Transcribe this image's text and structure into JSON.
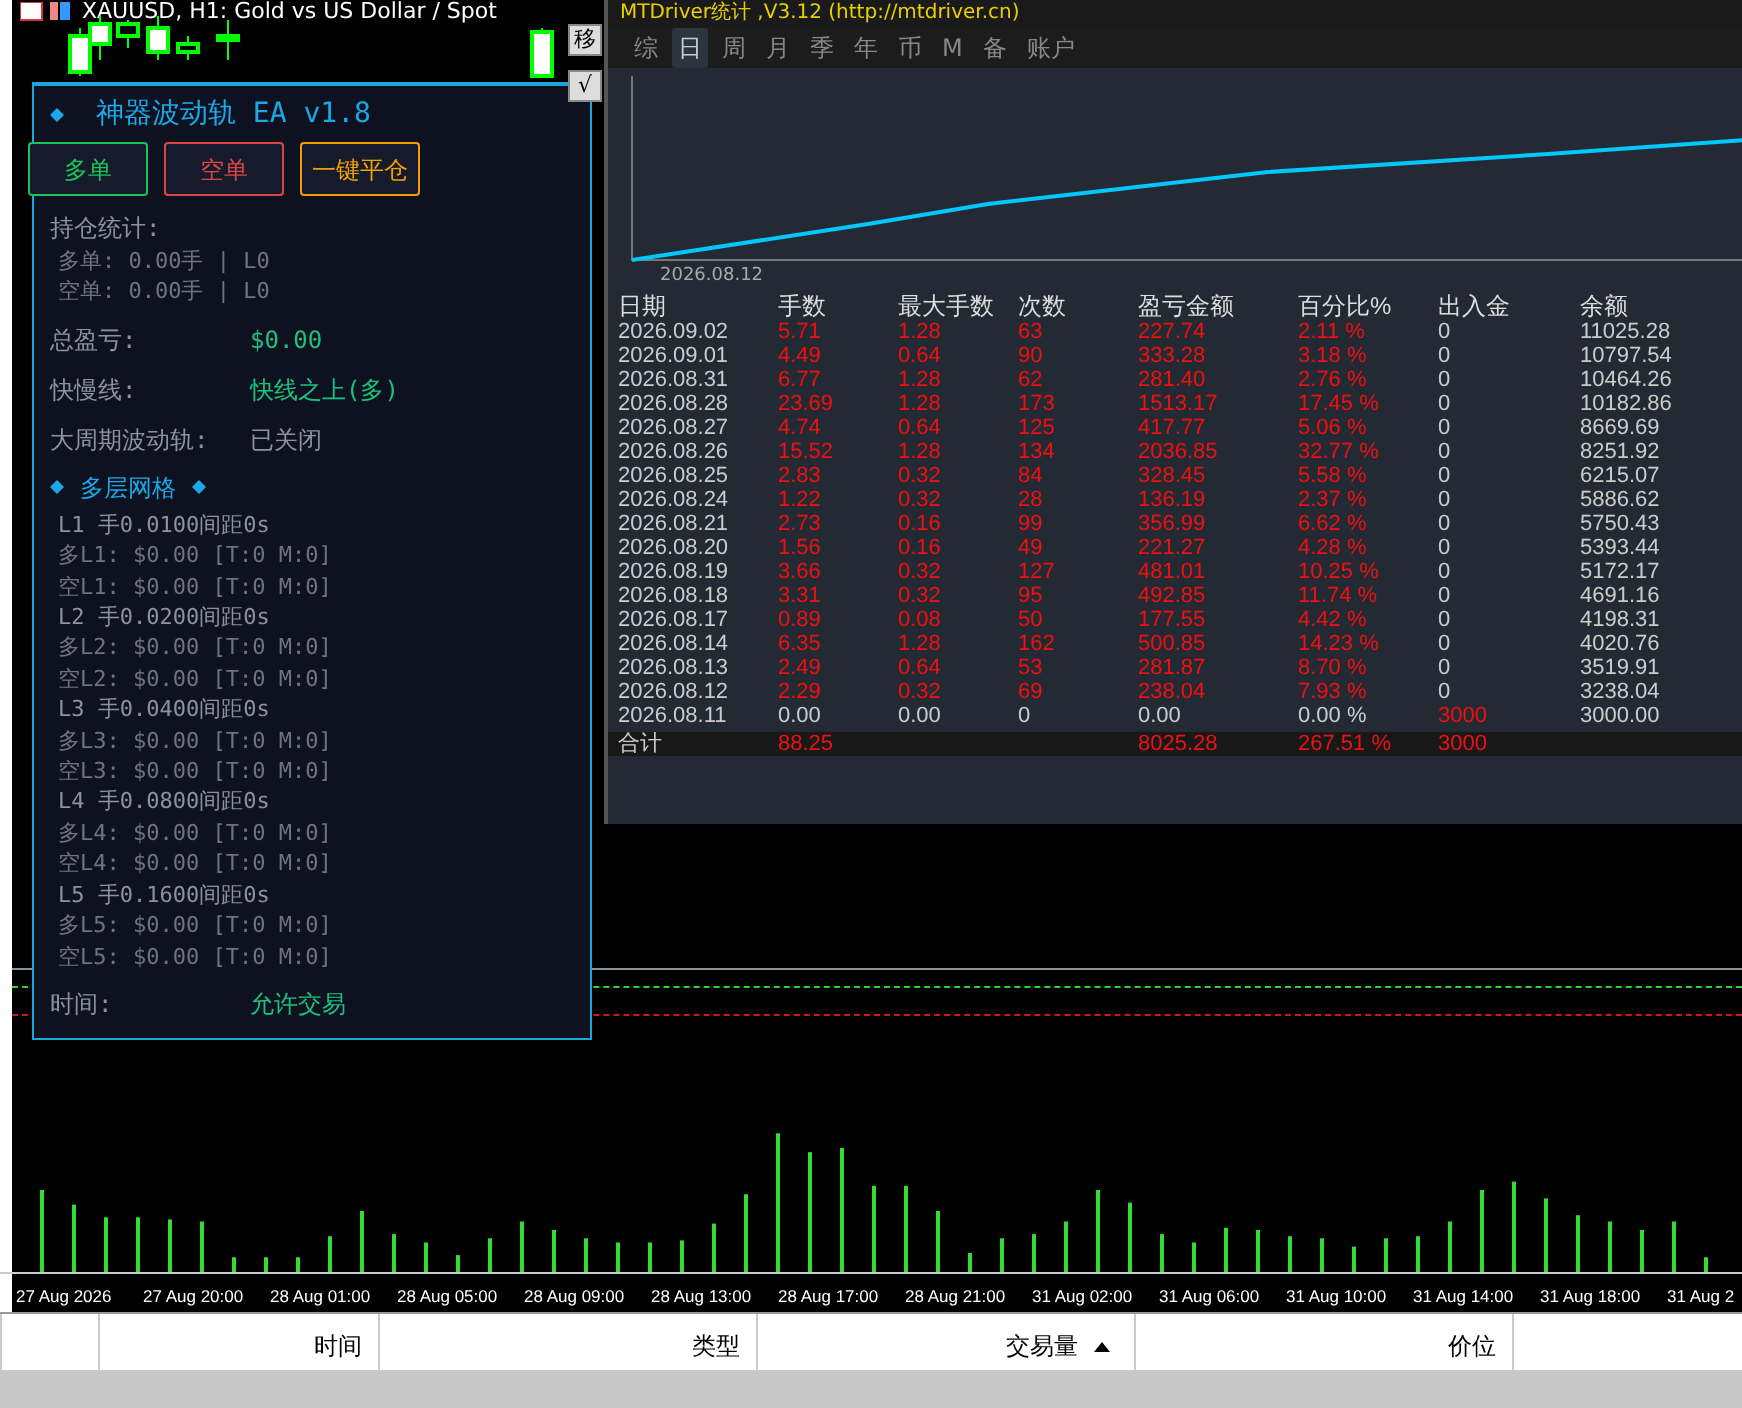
{
  "chart": {
    "title": "XAUUSD, H1: Gold vs US Dollar / Spot",
    "side_buttons": [
      "移",
      "√"
    ],
    "time_axis": [
      "27 Aug 2026",
      "27 Aug 20:00",
      "28 Aug 01:00",
      "28 Aug 05:00",
      "28 Aug 09:00",
      "28 Aug 13:00",
      "28 Aug 17:00",
      "28 Aug 21:00",
      "31 Aug 02:00",
      "31 Aug 06:00",
      "31 Aug 10:00",
      "31 Aug 14:00",
      "31 Aug 18:00",
      "31 Aug 2"
    ]
  },
  "ea_panel": {
    "title": "神器波动轨 EA v1.8",
    "buttons": [
      {
        "label": "多单",
        "kind": "buy"
      },
      {
        "label": "空单",
        "kind": "sell"
      },
      {
        "label": "一键平仓",
        "kind": "close"
      }
    ],
    "lines": [
      {
        "kind": "heading",
        "label": "持仓统计:"
      },
      {
        "kind": "sub",
        "label": "多单: 0.00手 | L0"
      },
      {
        "kind": "sub",
        "label": "空单: 0.00手 | L0"
      },
      {
        "kind": "pair",
        "label": "总盈亏:",
        "value": "$0.00",
        "on": true
      },
      {
        "kind": "pair",
        "label": "快慢线:",
        "value": "快线之上(多)",
        "on": true
      },
      {
        "kind": "pair",
        "label": "大周期波动轨:",
        "value": "已关闭",
        "on": false
      },
      {
        "kind": "section",
        "label": "多层网格"
      },
      {
        "kind": "level",
        "label": "L1 手0.0100间距0s"
      },
      {
        "kind": "sub",
        "label": "多L1: $0.00 [T:0 M:0]"
      },
      {
        "kind": "sub",
        "label": "空L1: $0.00 [T:0 M:0]"
      },
      {
        "kind": "level",
        "label": "L2 手0.0200间距0s"
      },
      {
        "kind": "sub",
        "label": "多L2: $0.00 [T:0 M:0]"
      },
      {
        "kind": "sub",
        "label": "空L2: $0.00 [T:0 M:0]"
      },
      {
        "kind": "level",
        "label": "L3 手0.0400间距0s"
      },
      {
        "kind": "sub",
        "label": "多L3: $0.00 [T:0 M:0]"
      },
      {
        "kind": "sub",
        "label": "空L3: $0.00 [T:0 M:0]"
      },
      {
        "kind": "level",
        "label": "L4 手0.0800间距0s"
      },
      {
        "kind": "sub",
        "label": "多L4: $0.00 [T:0 M:0]"
      },
      {
        "kind": "sub",
        "label": "空L4: $0.00 [T:0 M:0]"
      },
      {
        "kind": "level",
        "label": "L5 手0.1600间距0s"
      },
      {
        "kind": "sub",
        "label": "多L5: $0.00 [T:0 M:0]"
      },
      {
        "kind": "sub",
        "label": "空L5: $0.00 [T:0 M:0]"
      },
      {
        "kind": "pair",
        "label": "时间:",
        "value": "允许交易",
        "on": true
      }
    ]
  },
  "stats": {
    "title": "MTDriver统计 ,V3.12 (http://mtdriver.cn)",
    "tabs": [
      {
        "label": "综",
        "selected": false
      },
      {
        "label": "日",
        "selected": true
      },
      {
        "label": "周",
        "selected": false
      },
      {
        "label": "月",
        "selected": false
      },
      {
        "label": "季",
        "selected": false
      },
      {
        "label": "年",
        "selected": false
      },
      {
        "label": "币",
        "selected": false
      },
      {
        "label": "M",
        "selected": false
      },
      {
        "label": "备",
        "selected": false
      },
      {
        "label": "账户",
        "selected": false
      }
    ],
    "equity_chart": {
      "date_label": "2026.08.12"
    },
    "table": {
      "columns": [
        "日期",
        "手数",
        "最大手数",
        "次数",
        "盈亏金额",
        "百分比%",
        "出入金",
        "余额"
      ],
      "rows": [
        {
          "kind": "trade",
          "cells": [
            "2026.09.02",
            "5.71",
            "1.28",
            "63",
            "227.74",
            "2.11 %",
            "0",
            "11025.28"
          ]
        },
        {
          "kind": "trade",
          "cells": [
            "2026.09.01",
            "4.49",
            "0.64",
            "90",
            "333.28",
            "3.18 %",
            "0",
            "10797.54"
          ]
        },
        {
          "kind": "trade",
          "cells": [
            "2026.08.31",
            "6.77",
            "1.28",
            "62",
            "281.40",
            "2.76 %",
            "0",
            "10464.26"
          ]
        },
        {
          "kind": "trade",
          "cells": [
            "2026.08.28",
            "23.69",
            "1.28",
            "173",
            "1513.17",
            "17.45 %",
            "0",
            "10182.86"
          ]
        },
        {
          "kind": "trade",
          "cells": [
            "2026.08.27",
            "4.74",
            "0.64",
            "125",
            "417.77",
            "5.06 %",
            "0",
            "8669.69"
          ]
        },
        {
          "kind": "trade",
          "cells": [
            "2026.08.26",
            "15.52",
            "1.28",
            "134",
            "2036.85",
            "32.77 %",
            "0",
            "8251.92"
          ]
        },
        {
          "kind": "trade",
          "cells": [
            "2026.08.25",
            "2.83",
            "0.32",
            "84",
            "328.45",
            "5.58 %",
            "0",
            "6215.07"
          ]
        },
        {
          "kind": "trade",
          "cells": [
            "2026.08.24",
            "1.22",
            "0.32",
            "28",
            "136.19",
            "2.37 %",
            "0",
            "5886.62"
          ]
        },
        {
          "kind": "trade",
          "cells": [
            "2026.08.21",
            "2.73",
            "0.16",
            "99",
            "356.99",
            "6.62 %",
            "0",
            "5750.43"
          ]
        },
        {
          "kind": "trade",
          "cells": [
            "2026.08.20",
            "1.56",
            "0.16",
            "49",
            "221.27",
            "4.28 %",
            "0",
            "5393.44"
          ]
        },
        {
          "kind": "trade",
          "cells": [
            "2026.08.19",
            "3.66",
            "0.32",
            "127",
            "481.01",
            "10.25 %",
            "0",
            "5172.17"
          ]
        },
        {
          "kind": "trade",
          "cells": [
            "2026.08.18",
            "3.31",
            "0.32",
            "95",
            "492.85",
            "11.74 %",
            "0",
            "4691.16"
          ]
        },
        {
          "kind": "trade",
          "cells": [
            "2026.08.17",
            "0.89",
            "0.08",
            "50",
            "177.55",
            "4.42 %",
            "0",
            "4198.31"
          ]
        },
        {
          "kind": "trade",
          "cells": [
            "2026.08.14",
            "6.35",
            "1.28",
            "162",
            "500.85",
            "14.23 %",
            "0",
            "4020.76"
          ]
        },
        {
          "kind": "trade",
          "cells": [
            "2026.08.13",
            "2.49",
            "0.64",
            "53",
            "281.87",
            "8.70 %",
            "0",
            "3519.91"
          ]
        },
        {
          "kind": "trade",
          "cells": [
            "2026.08.12",
            "2.29",
            "0.32",
            "69",
            "238.04",
            "7.93 %",
            "0",
            "3238.04"
          ]
        },
        {
          "kind": "deposit",
          "cells": [
            "2026.08.11",
            "0.00",
            "0.00",
            "0",
            "0.00",
            "0.00 %",
            "3000",
            "3000.00"
          ]
        }
      ],
      "total": {
        "label": "合计",
        "lots": "88.25",
        "pnl": "8025.28",
        "percent": "267.51 %",
        "deposit": "3000"
      }
    }
  },
  "trade_header": {
    "columns": [
      {
        "label": "时间",
        "sorted": false
      },
      {
        "label": "类型",
        "sorted": false
      },
      {
        "label": "交易量",
        "sorted": true
      },
      {
        "label": "价位",
        "sorted": false
      }
    ]
  }
}
